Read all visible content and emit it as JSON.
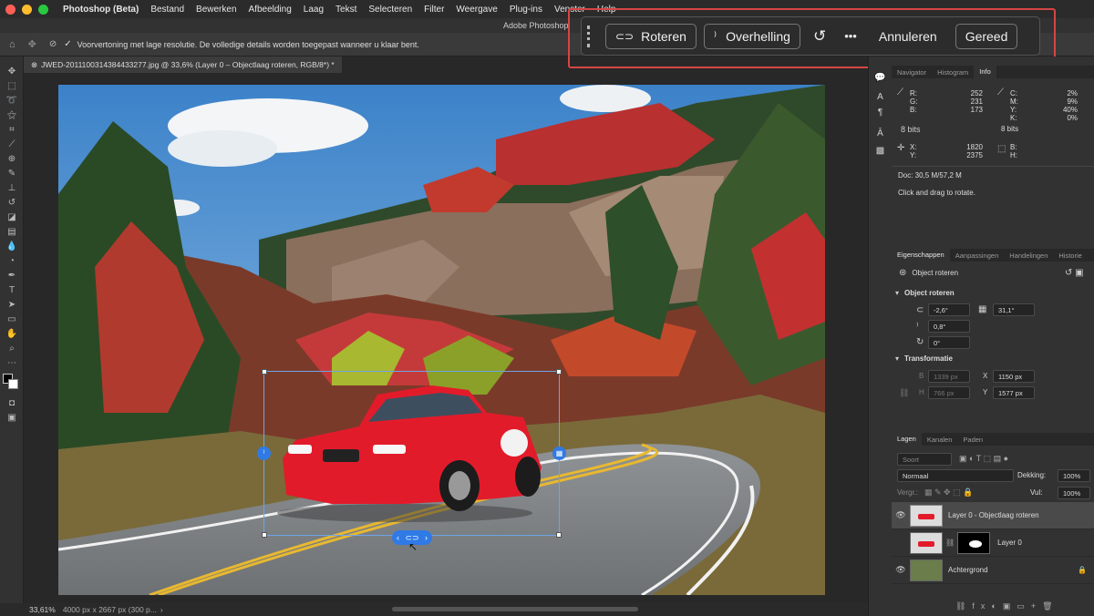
{
  "menubar": {
    "app": "Photoshop (Beta)",
    "items": [
      "Bestand",
      "Bewerken",
      "Afbeelding",
      "Laag",
      "Tekst",
      "Selecteren",
      "Filter",
      "Weergave",
      "Plug-ins",
      "Venster",
      "Help"
    ]
  },
  "window": {
    "title": "Adobe Photoshop"
  },
  "options": {
    "preview_text": "Voorvertoning met lage resolutie. De volledige details worden toegepast wanneer u klaar bent."
  },
  "document": {
    "tab_title": "JWED-2011100314384433277.jpg @ 33,6% (Layer 0 – Objectlaag roteren, RGB/8*) *"
  },
  "contextbar": {
    "rotate": "Roteren",
    "tilt": "Overhelling",
    "more": "•••",
    "cancel": "Annuleren",
    "done": "Gereed"
  },
  "info_panel": {
    "tabs": [
      "Navigator",
      "Histogram",
      "Info"
    ],
    "r_label": "R:",
    "r": "252",
    "g_label": "G:",
    "g": "231",
    "b_label": "B:",
    "b": "173",
    "bits1": "8 bits",
    "c_label": "C:",
    "c": "2%",
    "m_label": "M:",
    "m": "9%",
    "y_label": "Y:",
    "y": "40%",
    "k_label": "K:",
    "k": "0%",
    "bits2": "8 bits",
    "x_label": "X:",
    "x": "1820",
    "ypos_label": "Y:",
    "ypos": "2375",
    "w_label": "B:",
    "h_label": "H:",
    "doc_size": "Doc: 30,5 M/57,2 M",
    "hint": "Click and drag to rotate."
  },
  "properties": {
    "tabs": [
      "Eigenschappen",
      "Aanpassingen",
      "Handelingen",
      "Historie"
    ],
    "layer_type": "Object roteren",
    "section1": "Object roteren",
    "rotate_val": "-2,6°",
    "perspective_val": "31,1°",
    "tilt_val": "0,8°",
    "roll_val": "0°",
    "section2": "Transformatie",
    "w_label": "B",
    "w": "1339 px",
    "x_label": "X",
    "x": "1150 px",
    "h_label": "H",
    "h": "766 px",
    "y_label": "Y",
    "y": "1577 px"
  },
  "layers": {
    "tabs": [
      "Lagen",
      "Kanalen",
      "Paden"
    ],
    "search_placeholder": "Soort",
    "blend": "Normaal",
    "opacity_label": "Dekking:",
    "opacity": "100%",
    "lock_label": "Vergr.:",
    "fill_label": "Vul:",
    "fill": "100%",
    "items": [
      {
        "name": "Layer 0 - Objectlaag roteren"
      },
      {
        "name": "Layer 0"
      },
      {
        "name": "Achtergrond"
      }
    ]
  },
  "statusbar": {
    "zoom": "33,61%",
    "size": "4000 px x 2667 px (300 p..."
  },
  "colors": {
    "accent": "#2f7ae5",
    "highlight": "#d64545"
  }
}
